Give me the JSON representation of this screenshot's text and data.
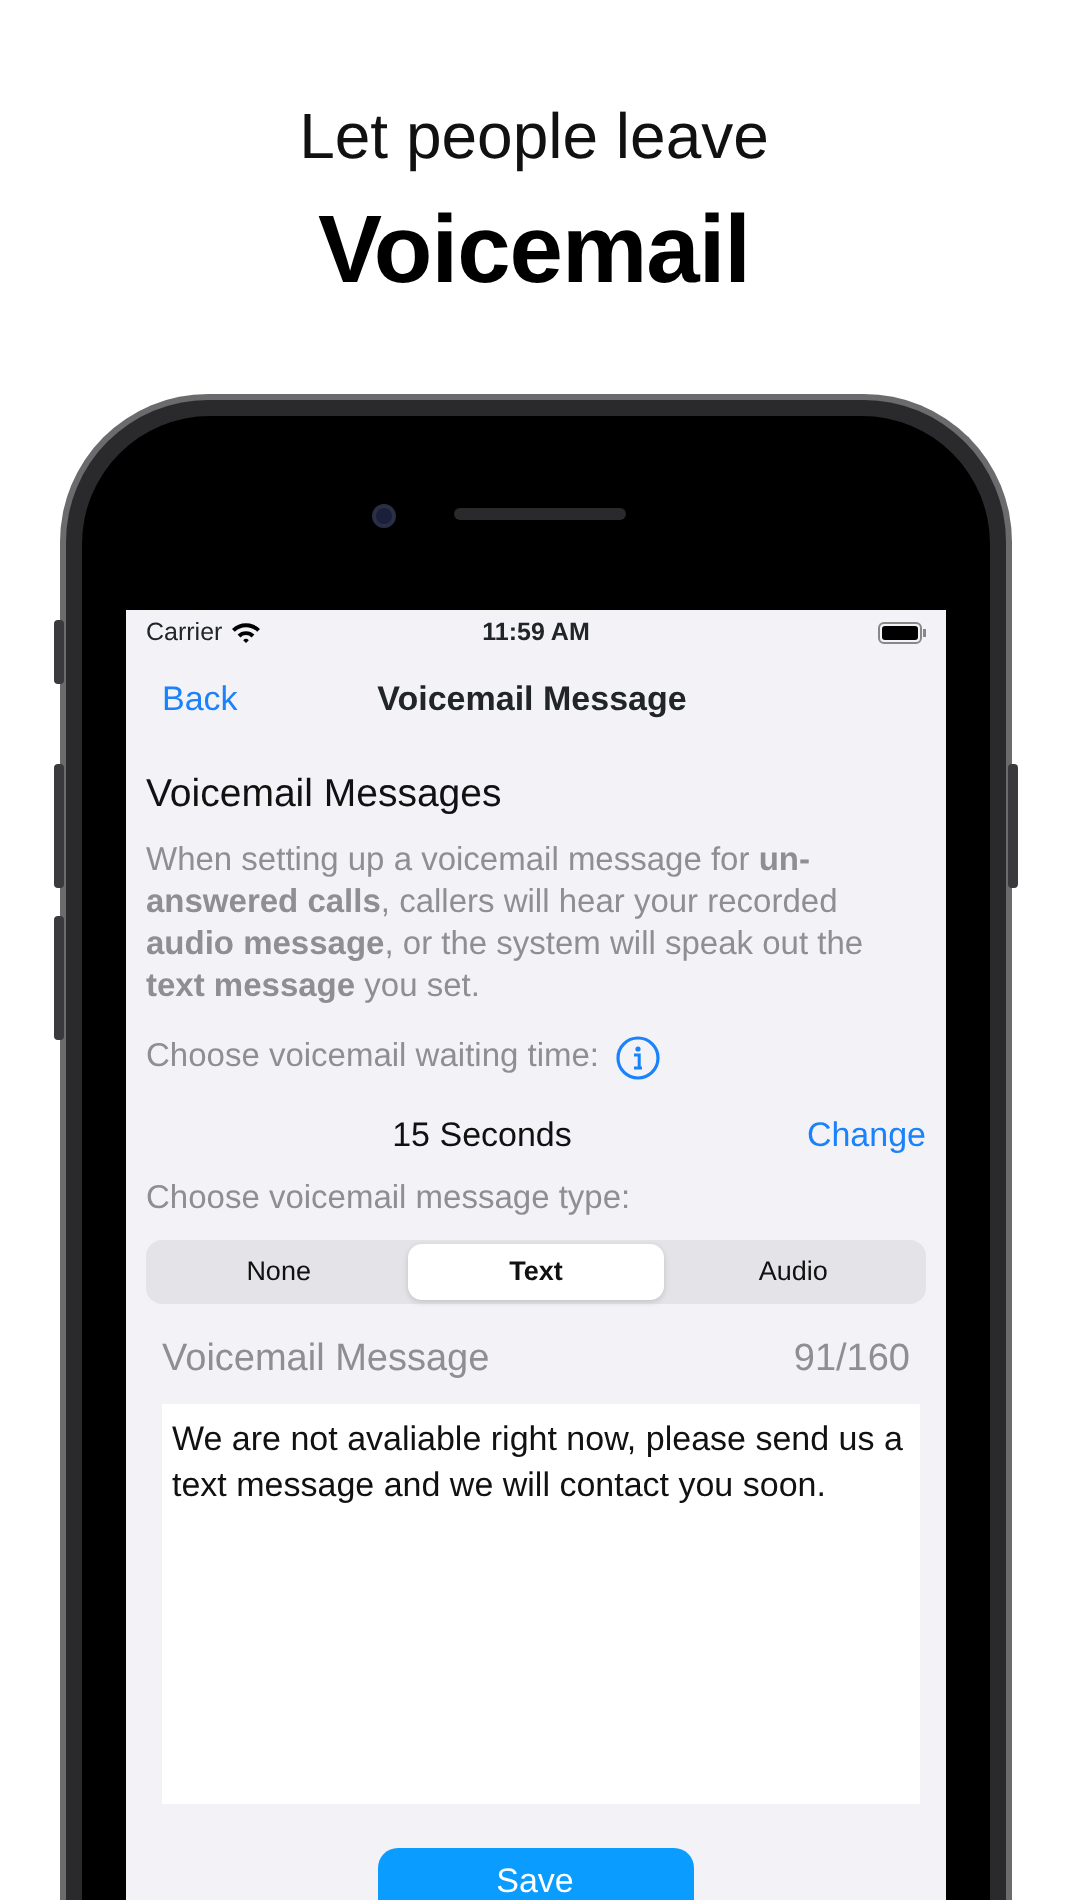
{
  "headline": {
    "line_1": "Let people leave",
    "line_2": "Voicemail"
  },
  "status_bar": {
    "carrier": "Carrier",
    "time": "11:59 AM"
  },
  "nav_bar": {
    "back": "Back",
    "title": "Voicemail Message"
  },
  "section_title": "Voicemail Messages",
  "description": "When setting up a voicemail message for **un-answered calls**, callers will hear your recorded **audio message**, or the system will speak out the **text message** you set.",
  "waiting_time": {
    "label": "Choose voicemail waiting time:",
    "value": "15 Seconds",
    "action": "Change"
  },
  "message_type": {
    "label": "Choose voicemail message type:",
    "options": [
      {
        "label": "None",
        "selected": false
      },
      {
        "label": "Text",
        "selected": true
      },
      {
        "label": "Audio",
        "selected": false
      }
    ]
  },
  "message": {
    "label": "Voicemail Message",
    "counter": "91/160",
    "value": "We are not avaliable right now, please send us a text message and we will contact you soon."
  },
  "save_button": "Save"
}
